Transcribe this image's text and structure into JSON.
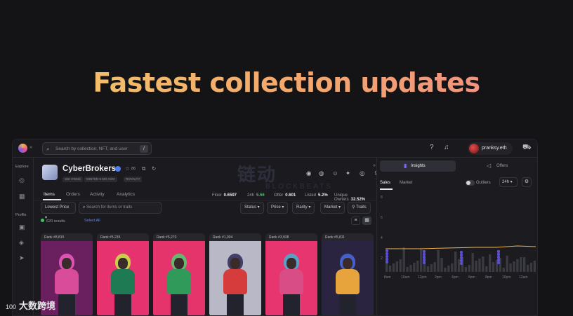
{
  "headline": "Fastest collection updates",
  "topbar": {
    "search_placeholder": "Search by collection, NFT, and user",
    "search_shortcut": "/",
    "username": "pranksy.eth"
  },
  "sidebar": {
    "explore_label": "Explore",
    "profile_label": "Profile"
  },
  "watermark": {
    "main": "链动",
    "sub": "BLOCKBEATS"
  },
  "collection": {
    "name": "CyberBrokers",
    "star_count": "86",
    "tags": [
      "10K ITEMS",
      "MINTED 6 MO AGO",
      "ROYALTY"
    ]
  },
  "tabs": [
    "Items",
    "Orders",
    "Activity",
    "Analytics"
  ],
  "stats": [
    {
      "label": "Floor",
      "value": "0.6597",
      "positive": false
    },
    {
      "label": "24h",
      "value": "5.56",
      "positive": true
    },
    {
      "label": "Offer",
      "value": "0.601",
      "positive": false
    },
    {
      "label": "Listed",
      "value": "5.2%",
      "positive": false
    },
    {
      "label": "Unique Owners",
      "value": "32.52%",
      "positive": false
    }
  ],
  "filters": {
    "sort": "Lowest Price",
    "search_placeholder": "Search for items or traits",
    "status": "Status",
    "price": "Price",
    "rarity": "Rarity",
    "market": "Market",
    "traits": "Traits"
  },
  "results": {
    "count": "620 results",
    "select_all": "Select All"
  },
  "cards": [
    {
      "rank": "Rank #8,815",
      "bg": "#6a1f5e",
      "body": "#d94c9a",
      "accent": "#f05cc0"
    },
    {
      "rank": "Rank #5,235",
      "bg": "#e6336f",
      "body": "#1e7a52",
      "accent": "#c6e646"
    },
    {
      "rank": "Rank #5,270",
      "bg": "#e4346b",
      "body": "#2f9a5a",
      "accent": "#4fd16e"
    },
    {
      "rank": "Rank #1,904",
      "bg": "#b8b8c6",
      "body": "#d63c3c",
      "accent": "#2a2a55"
    },
    {
      "rank": "Rank #3,938",
      "bg": "#e6356f",
      "body": "#d94d86",
      "accent": "#3fb3d6"
    },
    {
      "rank": "Rank #5,811",
      "bg": "#2a2440",
      "body": "#e8a43c",
      "accent": "#4a6ae6"
    }
  ],
  "insights": {
    "tab_label": "Insights",
    "offers_label": "Offers",
    "sales_tab": "Sales",
    "market_tab": "Market",
    "outliers_label": "Outliers",
    "range": "24h",
    "y_labels": [
      "8",
      "6",
      "4",
      "2"
    ],
    "x_labels": [
      "8am",
      "10am",
      "12pm",
      "2pm",
      "4pm",
      "6pm",
      "8pm",
      "10pm",
      "12am"
    ]
  },
  "footer_watermark": {
    "number": "100",
    "text": "大数跨境"
  }
}
